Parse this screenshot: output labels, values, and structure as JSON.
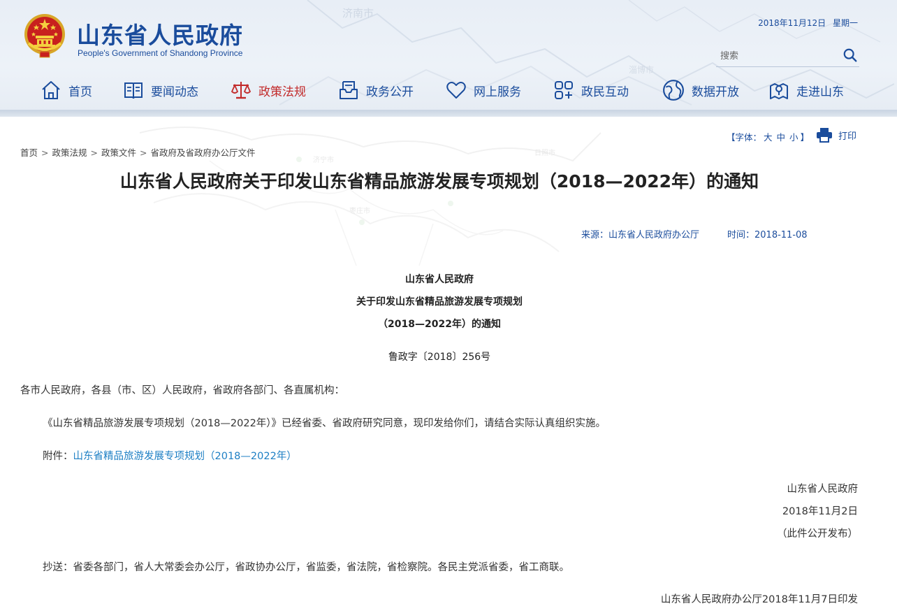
{
  "header": {
    "title": "山东省人民政府",
    "subtitle": "People's Government of Shandong Province",
    "date": "2018年11月12日",
    "weekday": "星期一",
    "map_label": "济南市",
    "map_label2": "淄博市",
    "search_placeholder": "搜索",
    "brand_color": "#1a4c9c",
    "active_color": "#c22a2a"
  },
  "nav": {
    "items": [
      {
        "label": "首页",
        "icon": "home-icon"
      },
      {
        "label": "要闻动态",
        "icon": "newspaper-icon"
      },
      {
        "label": "政策法规",
        "icon": "scales-icon",
        "active": true
      },
      {
        "label": "政务公开",
        "icon": "inbox-icon"
      },
      {
        "label": "网上服务",
        "icon": "heart-icon"
      },
      {
        "label": "政民互动",
        "icon": "interaction-icon"
      },
      {
        "label": "数据开放",
        "icon": "globe-icon"
      },
      {
        "label": "走进山东",
        "icon": "map-pin-icon"
      }
    ]
  },
  "toolbar": {
    "font_open": "【字体：",
    "font_large": "大",
    "font_medium": "中",
    "font_small": "小",
    "font_close": "】",
    "print_label": "打印"
  },
  "breadcrumb": [
    "首页",
    "政策法规",
    "政策文件",
    "省政府及省政府办公厅文件"
  ],
  "article": {
    "title": "山东省人民政府关于印发山东省精品旅游发展专项规划（2018—2022年）的通知",
    "source": "来源：山东省人民政府办公厅",
    "time": "时间：2018-11-08",
    "map_labels": [
      "济宁市",
      "日照市",
      "枣庄市"
    ],
    "head_line1": "山东省人民政府",
    "head_line2": "关于印发山东省精品旅游发展专项规划",
    "head_line3": "（2018—2022年）的通知",
    "doc_number": "鲁政字〔2018〕256号",
    "recipients": "各市人民政府，各县（市、区）人民政府，省政府各部门、各直属机构：",
    "body": "《山东省精品旅游发展专项规划（2018—2022年）》已经省委、省政府研究同意，现印发给你们，请结合实际认真组织实施。",
    "attachment_label": "附件：",
    "attachment_link": "山东省精品旅游发展专项规划（2018—2022年）",
    "signature": "山东省人民政府",
    "sign_date": "2018年11月2日",
    "publish_note": "（此件公开发布）",
    "cc": "抄送：省委各部门，省人大常委会办公厅，省政协办公厅，省监委，省法院，省检察院。各民主党派省委，省工商联。",
    "issue_line": "山东省人民政府办公厅2018年11月7日印发",
    "link_color": "#1d7fc4"
  }
}
